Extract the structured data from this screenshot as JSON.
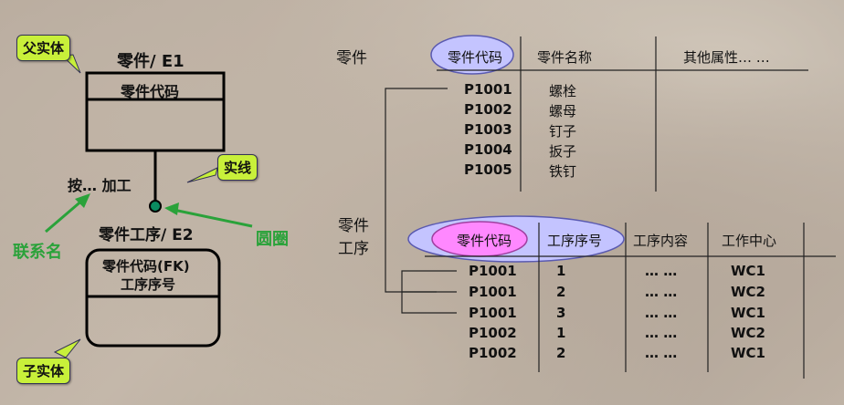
{
  "left": {
    "callout_parent": "父实体",
    "parent_title": "零件/ E1",
    "parent_key": "零件代码",
    "callout_solid": "实线",
    "relation_text": "按… 加工",
    "child_title": "零件工序/ E2",
    "label_rel_name": "联系名",
    "label_circle": "圆圈",
    "child_key_1": "零件代码(FK)",
    "child_key_2": "工序序号",
    "callout_child": "子实体"
  },
  "parts": {
    "label": "零件",
    "headers": [
      "零件代码",
      "零件名称",
      "其他属性… …"
    ],
    "rows": [
      [
        "P1001",
        "螺栓"
      ],
      [
        "P1002",
        "螺母"
      ],
      [
        "P1003",
        "钉子"
      ],
      [
        "P1004",
        "扳子"
      ],
      [
        "P1005",
        "铁钉"
      ]
    ]
  },
  "proc": {
    "label_line1": "零件",
    "label_line2": "工序",
    "headers": [
      "零件代码",
      "工序序号",
      "工序内容",
      "工作中心"
    ],
    "rows": [
      [
        "P1001",
        "1",
        "… …",
        "WC1"
      ],
      [
        "P1001",
        "2",
        "… …",
        "WC2"
      ],
      [
        "P1001",
        "3",
        "… …",
        "WC1"
      ],
      [
        "P1002",
        "1",
        "… …",
        "WC2"
      ],
      [
        "P1002",
        "2",
        "… …",
        "WC1"
      ]
    ]
  },
  "colors": {
    "callout": "#c8f03a",
    "ellipse": "#c4c4ff",
    "highlight": "#ff88ff",
    "green": "#2aa23a"
  }
}
